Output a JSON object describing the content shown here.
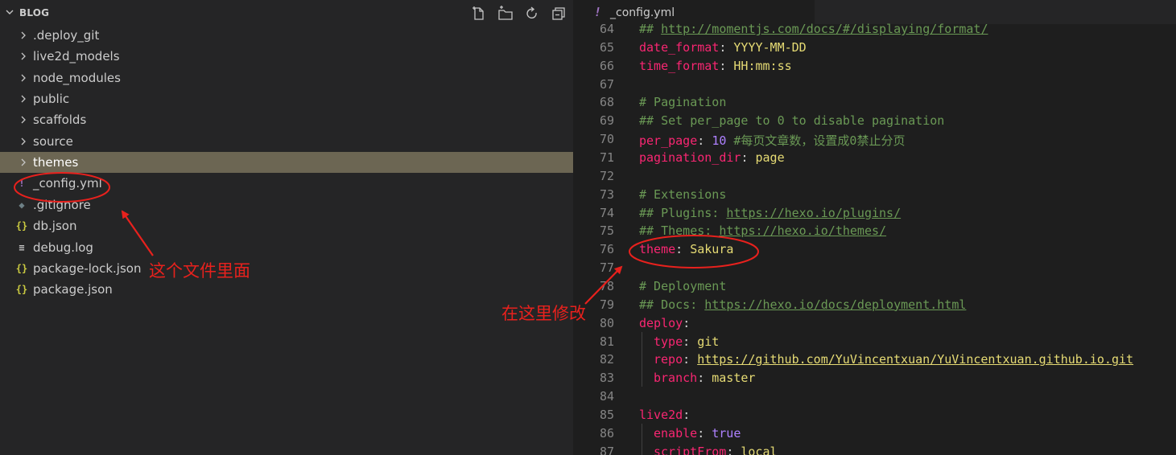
{
  "explorer": {
    "title": "BLOG",
    "items": [
      {
        "label": ".deploy_git",
        "type": "folder",
        "icon": "chevron-right-icon"
      },
      {
        "label": "live2d_models",
        "type": "folder",
        "icon": "chevron-right-icon"
      },
      {
        "label": "node_modules",
        "type": "folder",
        "icon": "chevron-right-icon"
      },
      {
        "label": "public",
        "type": "folder",
        "icon": "chevron-right-icon"
      },
      {
        "label": "scaffolds",
        "type": "folder",
        "icon": "chevron-right-icon"
      },
      {
        "label": "source",
        "type": "folder",
        "icon": "chevron-right-icon"
      },
      {
        "label": "themes",
        "type": "folder",
        "icon": "chevron-right-icon",
        "selected": true
      },
      {
        "label": "_config.yml",
        "type": "file",
        "icon": "yaml-file-icon",
        "glyph": "!",
        "color": "#a074c4"
      },
      {
        "label": ".gitignore",
        "type": "file",
        "icon": "git-file-icon",
        "glyph": "◆",
        "color": "#6d8086"
      },
      {
        "label": "db.json",
        "type": "file",
        "icon": "json-file-icon",
        "glyph": "{}",
        "color": "#cbcb41"
      },
      {
        "label": "debug.log",
        "type": "file",
        "icon": "log-file-icon",
        "glyph": "≡",
        "color": "#c5c5c5"
      },
      {
        "label": "package-lock.json",
        "type": "file",
        "icon": "json-file-icon",
        "glyph": "{}",
        "color": "#cbcb41"
      },
      {
        "label": "package.json",
        "type": "file",
        "icon": "json-file-icon",
        "glyph": "{}",
        "color": "#cbcb41"
      }
    ],
    "header_actions": [
      "new-file-icon",
      "new-folder-icon",
      "refresh-icon",
      "collapse-all-icon"
    ]
  },
  "editor": {
    "tab": {
      "label": "_config.yml",
      "icon": "yaml-file-icon",
      "glyph": "!"
    },
    "lines": [
      {
        "n": "64",
        "tokens": [
          {
            "t": "## ",
            "c": "t-comment"
          },
          {
            "t": "http://momentjs.com/docs/#/displaying/format/",
            "c": "t-comment-u"
          }
        ]
      },
      {
        "n": "65",
        "tokens": [
          {
            "t": "date_format",
            "c": "t-key"
          },
          {
            "t": ": ",
            "c": "t-colon"
          },
          {
            "t": "YYYY-MM-DD",
            "c": "t-str"
          }
        ]
      },
      {
        "n": "66",
        "tokens": [
          {
            "t": "time_format",
            "c": "t-key"
          },
          {
            "t": ": ",
            "c": "t-colon"
          },
          {
            "t": "HH:mm:ss",
            "c": "t-str"
          }
        ]
      },
      {
        "n": "67",
        "tokens": []
      },
      {
        "n": "68",
        "tokens": [
          {
            "t": "# Pagination",
            "c": "t-comment"
          }
        ]
      },
      {
        "n": "69",
        "tokens": [
          {
            "t": "## Set per_page to 0 to disable pagination",
            "c": "t-comment"
          }
        ]
      },
      {
        "n": "70",
        "tokens": [
          {
            "t": "per_page",
            "c": "t-key"
          },
          {
            "t": ": ",
            "c": "t-colon"
          },
          {
            "t": "10",
            "c": "t-num"
          },
          {
            "t": " #每页文章数，设置成0禁止分页",
            "c": "t-comment"
          }
        ]
      },
      {
        "n": "71",
        "tokens": [
          {
            "t": "pagination_dir",
            "c": "t-key"
          },
          {
            "t": ": ",
            "c": "t-colon"
          },
          {
            "t": "page",
            "c": "t-str"
          }
        ]
      },
      {
        "n": "72",
        "tokens": []
      },
      {
        "n": "73",
        "tokens": [
          {
            "t": "# Extensions",
            "c": "t-comment"
          }
        ]
      },
      {
        "n": "74",
        "tokens": [
          {
            "t": "## Plugins: ",
            "c": "t-comment"
          },
          {
            "t": "https://hexo.io/plugins/",
            "c": "t-comment-u"
          }
        ]
      },
      {
        "n": "75",
        "tokens": [
          {
            "t": "## Themes: ",
            "c": "t-comment"
          },
          {
            "t": "https://hexo.io/themes/",
            "c": "t-comment-u"
          }
        ]
      },
      {
        "n": "76",
        "tokens": [
          {
            "t": "theme",
            "c": "t-key"
          },
          {
            "t": ": ",
            "c": "t-colon"
          },
          {
            "t": "Sakura",
            "c": "t-str"
          }
        ]
      },
      {
        "n": "77",
        "tokens": []
      },
      {
        "n": "78",
        "tokens": [
          {
            "t": "# Deployment",
            "c": "t-comment"
          }
        ]
      },
      {
        "n": "79",
        "tokens": [
          {
            "t": "## Docs: ",
            "c": "t-comment"
          },
          {
            "t": "https://hexo.io/docs/deployment.html",
            "c": "t-comment-u"
          }
        ]
      },
      {
        "n": "80",
        "tokens": [
          {
            "t": "deploy",
            "c": "t-key"
          },
          {
            "t": ":",
            "c": "t-colon"
          }
        ]
      },
      {
        "n": "81",
        "indent": true,
        "tokens": [
          {
            "t": "type",
            "c": "t-key"
          },
          {
            "t": ": ",
            "c": "t-colon"
          },
          {
            "t": "git",
            "c": "t-str"
          }
        ]
      },
      {
        "n": "82",
        "indent": true,
        "tokens": [
          {
            "t": "repo",
            "c": "t-key"
          },
          {
            "t": ": ",
            "c": "t-colon"
          },
          {
            "t": "https://github.com/YuVincentxuan/YuVincentxuan.github.io.git",
            "c": "t-url"
          }
        ]
      },
      {
        "n": "83",
        "indent": true,
        "tokens": [
          {
            "t": "branch",
            "c": "t-key"
          },
          {
            "t": ": ",
            "c": "t-colon"
          },
          {
            "t": "master",
            "c": "t-str"
          }
        ]
      },
      {
        "n": "84",
        "tokens": []
      },
      {
        "n": "85",
        "tokens": [
          {
            "t": "live2d",
            "c": "t-key"
          },
          {
            "t": ":",
            "c": "t-colon"
          }
        ]
      },
      {
        "n": "86",
        "indent": true,
        "tokens": [
          {
            "t": "enable",
            "c": "t-key"
          },
          {
            "t": ": ",
            "c": "t-colon"
          },
          {
            "t": "true",
            "c": "t-bool"
          }
        ]
      },
      {
        "n": "87",
        "indent": true,
        "tokens": [
          {
            "t": "scriptFrom",
            "c": "t-key"
          },
          {
            "t": ": ",
            "c": "t-colon"
          },
          {
            "t": "local",
            "c": "t-str"
          }
        ]
      }
    ]
  },
  "annotations": {
    "file_note": "这个文件里面",
    "edit_note": "在这里修改",
    "color": "#e8211d"
  }
}
